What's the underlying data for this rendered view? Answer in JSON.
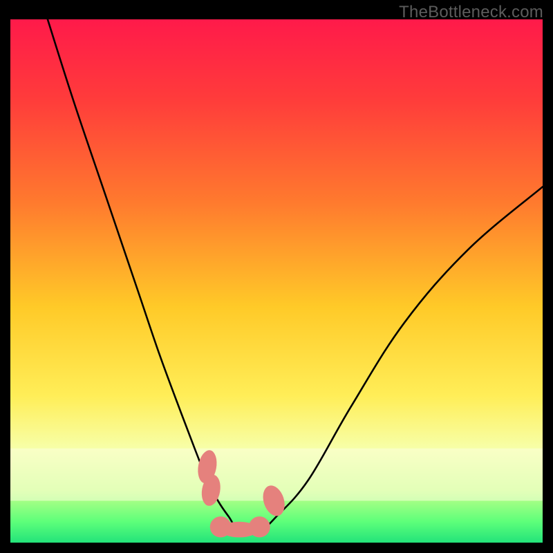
{
  "watermark": "TheBottleneck.com",
  "chart_data": {
    "type": "line",
    "title": "",
    "xlabel": "",
    "ylabel": "",
    "xlim": [
      0,
      100
    ],
    "ylim": [
      0,
      100
    ],
    "gradient_stops": [
      {
        "offset": 0.0,
        "color": "#ff1a4a"
      },
      {
        "offset": 0.15,
        "color": "#ff3b3b"
      },
      {
        "offset": 0.35,
        "color": "#ff7a2e"
      },
      {
        "offset": 0.55,
        "color": "#ffca28"
      },
      {
        "offset": 0.72,
        "color": "#ffee58"
      },
      {
        "offset": 0.82,
        "color": "#f7ffa8"
      },
      {
        "offset": 0.9,
        "color": "#c6ff8a"
      },
      {
        "offset": 0.96,
        "color": "#5dff7a"
      },
      {
        "offset": 1.0,
        "color": "#23e37a"
      }
    ],
    "series": [
      {
        "name": "curve",
        "x": [
          7,
          12,
          18,
          24,
          28,
          32,
          35,
          37,
          39,
          41,
          43,
          47,
          50,
          56,
          64,
          74,
          86,
          100
        ],
        "y": [
          100,
          84,
          66,
          48,
          36,
          25,
          17,
          12,
          8,
          5,
          2.5,
          2.5,
          5,
          12,
          26,
          42,
          56,
          68
        ]
      }
    ],
    "flat_segment": {
      "x0": 39,
      "x1": 47,
      "y": 2.5
    },
    "markers": [
      {
        "cx": 37.0,
        "cy": 14.5,
        "rx": 1.7,
        "ry": 3.2,
        "rot": 10
      },
      {
        "cx": 37.7,
        "cy": 10.0,
        "rx": 1.7,
        "ry": 3.0,
        "rot": 10
      },
      {
        "cx": 39.5,
        "cy": 3.0,
        "rx": 2.0,
        "ry": 2.0,
        "rot": 0
      },
      {
        "cx": 43.0,
        "cy": 2.5,
        "rx": 3.5,
        "ry": 1.5,
        "rot": 0
      },
      {
        "cx": 46.8,
        "cy": 3.0,
        "rx": 2.0,
        "ry": 2.0,
        "rot": 0
      },
      {
        "cx": 49.5,
        "cy": 8.0,
        "rx": 1.9,
        "ry": 3.0,
        "rot": -18
      }
    ],
    "marker_color": "#e5817d"
  }
}
